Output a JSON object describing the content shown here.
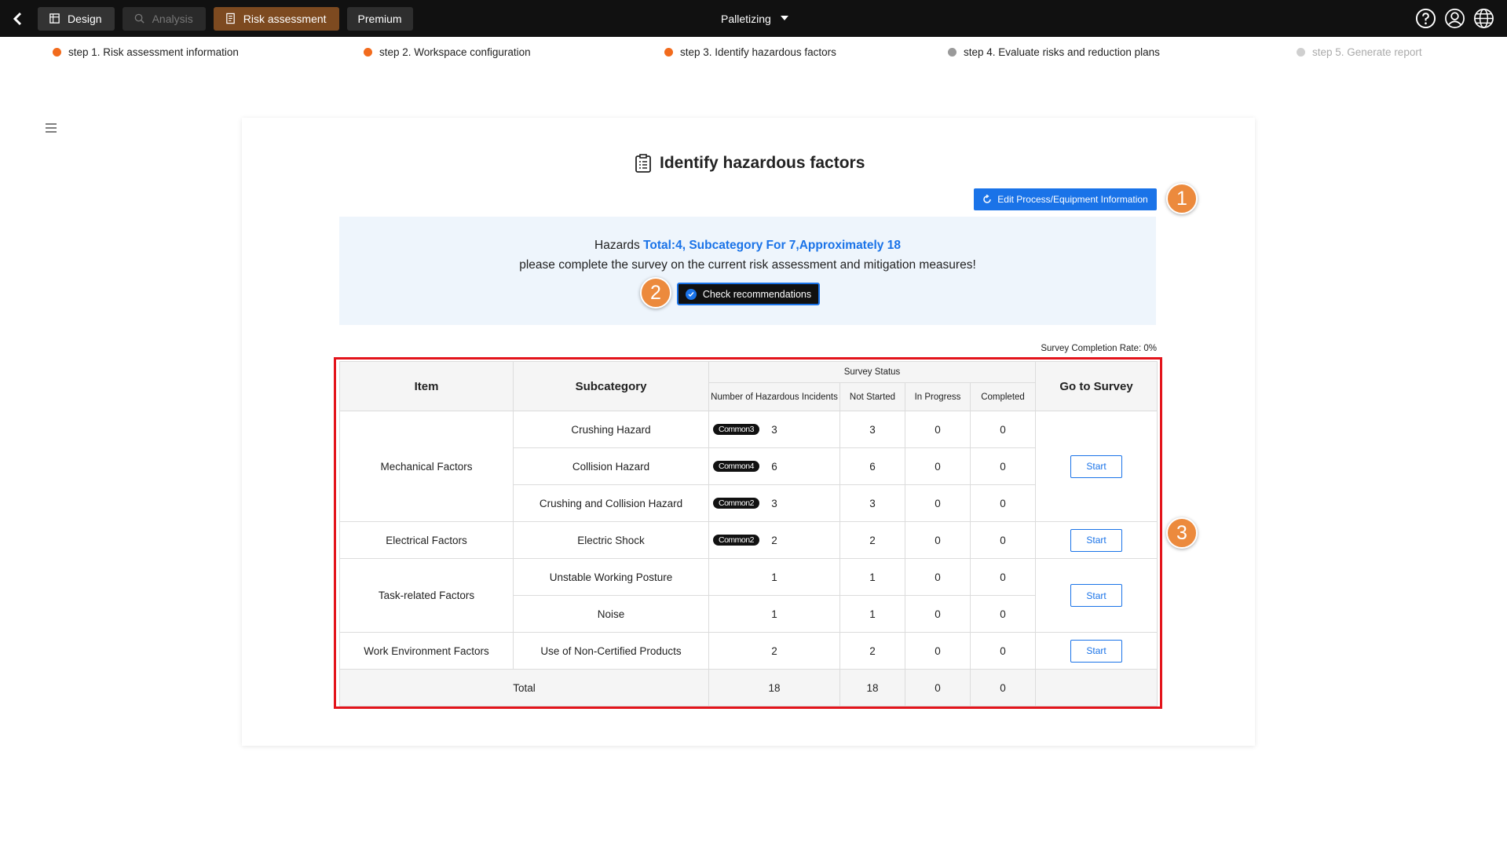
{
  "topbar": {
    "tabs": [
      {
        "label": "Design",
        "state": "normal"
      },
      {
        "label": "Analysis",
        "state": "disabled"
      },
      {
        "label": "Risk assessment",
        "state": "active"
      },
      {
        "label": "Premium",
        "state": "normal"
      }
    ],
    "project": "Palletizing",
    "icons": [
      "help-icon",
      "user-icon",
      "globe-icon"
    ]
  },
  "steps": [
    {
      "label": "step 1. Risk assessment information",
      "status": "done"
    },
    {
      "label": "step 2. Workspace configuration",
      "status": "done"
    },
    {
      "label": "step 3. Identify hazardous factors",
      "status": "current"
    },
    {
      "label": "step 4. Evaluate risks and reduction plans",
      "status": "pending"
    },
    {
      "label": "step 5. Generate report",
      "status": "disabled"
    }
  ],
  "page": {
    "title": "Identify hazardous factors",
    "edit_button": "Edit Process/Equipment Information",
    "info_prefix": "Hazards ",
    "info_highlight": "Total:4, Subcategory For 7,Approximately 18",
    "info_line2": "please complete the survey on the current risk assessment and mitigation measures!",
    "recommend_button": "Check recommendations",
    "completion_rate": "Survey Completion Rate: 0%"
  },
  "callouts": [
    "1",
    "2",
    "3"
  ],
  "table": {
    "headers": {
      "item": "Item",
      "subcategory": "Subcategory",
      "survey_status": "Survey Status",
      "num_incidents": "Number of Hazardous Incidents",
      "not_started": "Not Started",
      "in_progress": "In Progress",
      "completed": "Completed",
      "go_to_survey": "Go to Survey"
    },
    "groups": [
      {
        "item": "Mechanical Factors",
        "button": "Start"
      },
      {
        "item": "Electrical Factors",
        "button": "Start"
      },
      {
        "item": "Task-related Factors",
        "button": "Start"
      },
      {
        "item": "Work Environment Factors",
        "button": "Start"
      }
    ],
    "rows": [
      {
        "sub": "Crushing Hazard",
        "tag": "Common3",
        "num": "3",
        "ns": "3",
        "ip": "0",
        "c": "0"
      },
      {
        "sub": "Collision Hazard",
        "tag": "Common4",
        "num": "6",
        "ns": "6",
        "ip": "0",
        "c": "0"
      },
      {
        "sub": "Crushing and Collision Hazard",
        "tag": "Common2",
        "num": "3",
        "ns": "3",
        "ip": "0",
        "c": "0"
      },
      {
        "sub": "Electric Shock",
        "tag": "Common2",
        "num": "2",
        "ns": "2",
        "ip": "0",
        "c": "0"
      },
      {
        "sub": "Unstable Working Posture",
        "tag": "",
        "num": "1",
        "ns": "1",
        "ip": "0",
        "c": "0"
      },
      {
        "sub": "Noise",
        "tag": "",
        "num": "1",
        "ns": "1",
        "ip": "0",
        "c": "0"
      },
      {
        "sub": "Use of Non-Certified Products",
        "tag": "",
        "num": "2",
        "ns": "2",
        "ip": "0",
        "c": "0"
      }
    ],
    "total": {
      "label": "Total",
      "num": "18",
      "ns": "18",
      "ip": "0",
      "c": "0"
    }
  }
}
